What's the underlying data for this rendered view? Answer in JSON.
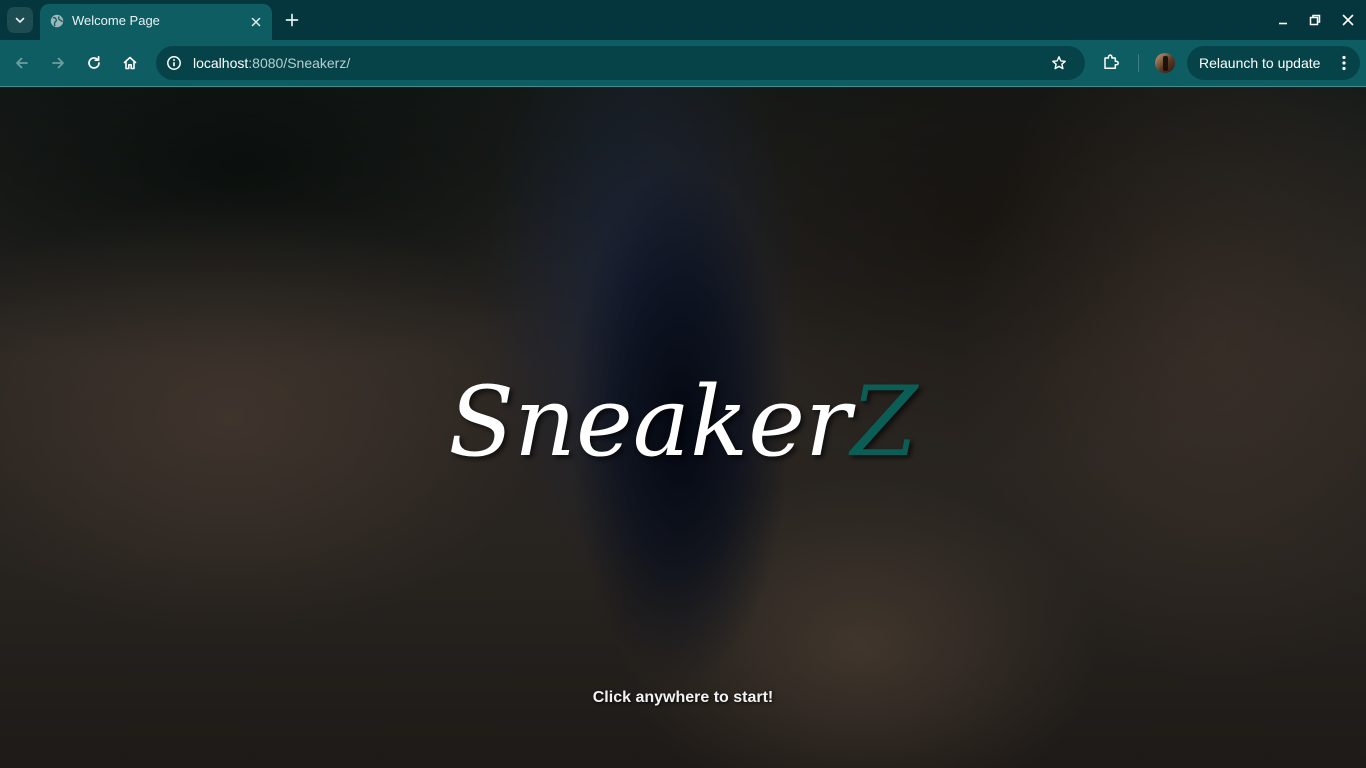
{
  "browser": {
    "tab": {
      "title": "Welcome Page",
      "favicon": "globe-icon"
    },
    "address_bar": {
      "host": "localhost",
      "path": ":8080/Sneakerz/"
    },
    "relaunch_label": "Relaunch to update",
    "colors": {
      "frame": "#06363d",
      "toolbar": "#0e5d63",
      "omnibox": "#064349"
    }
  },
  "page": {
    "logo": {
      "main": "Sneaker",
      "accent": "Z"
    },
    "start_hint": "Click anywhere to start!",
    "colors": {
      "logo_main": "#ffffff",
      "logo_accent": "#0b5e56"
    }
  }
}
